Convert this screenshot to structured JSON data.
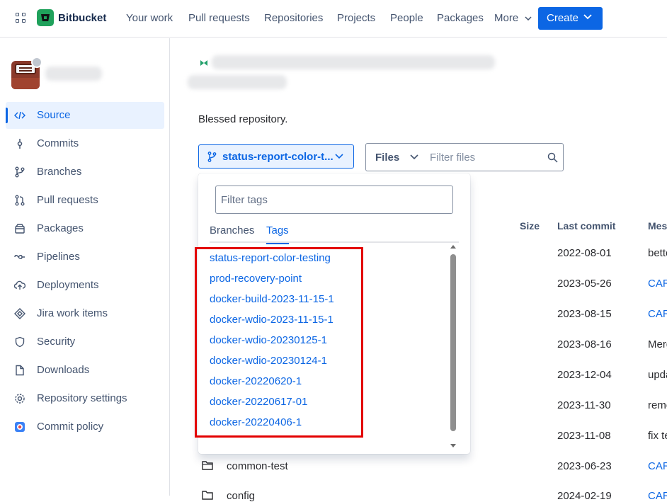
{
  "topnav": {
    "brand": "Bitbucket",
    "items": [
      "Your work",
      "Pull requests",
      "Repositories",
      "Projects",
      "People",
      "Packages",
      "More"
    ],
    "create_label": "Create"
  },
  "sidebar": {
    "items": [
      {
        "label": "Source",
        "icon": "code-icon",
        "active": true
      },
      {
        "label": "Commits",
        "icon": "commit-icon"
      },
      {
        "label": "Branches",
        "icon": "branch-icon"
      },
      {
        "label": "Pull requests",
        "icon": "pull-request-icon"
      },
      {
        "label": "Packages",
        "icon": "package-icon"
      },
      {
        "label": "Pipelines",
        "icon": "pipeline-icon"
      },
      {
        "label": "Deployments",
        "icon": "cloud-upload-icon"
      },
      {
        "label": "Jira work items",
        "icon": "jira-icon"
      },
      {
        "label": "Security",
        "icon": "shield-icon"
      },
      {
        "label": "Downloads",
        "icon": "file-icon"
      },
      {
        "label": "Repository settings",
        "icon": "gear-icon"
      },
      {
        "label": "Commit policy",
        "icon": "policy-icon"
      }
    ]
  },
  "main": {
    "description": "Blessed repository.",
    "branch_label": "status-report-color-t...",
    "files_label": "Files",
    "files_placeholder": "Filter files",
    "table_headers": {
      "size": "Size",
      "last_commit": "Last commit",
      "message": "Mes"
    },
    "rows": [
      {
        "name": "",
        "date": "2022-08-01",
        "msg": "bette",
        "link": false
      },
      {
        "name": "",
        "date": "2023-05-26",
        "msg": "CAR",
        "link": true
      },
      {
        "name": "",
        "date": "2023-08-15",
        "msg": "CAR",
        "link": true
      },
      {
        "name": "",
        "date": "2023-08-16",
        "msg": "Merg",
        "link": false
      },
      {
        "name": "",
        "date": "2023-12-04",
        "msg": "upda",
        "link": false
      },
      {
        "name": "",
        "date": "2023-11-30",
        "msg": "remo",
        "link": false
      },
      {
        "name": "",
        "date": "2023-11-08",
        "msg": "fix te",
        "link": false
      },
      {
        "name": "common-test",
        "date": "2023-06-23",
        "msg": "CAR",
        "link": true
      },
      {
        "name": "config",
        "date": "2024-02-19",
        "msg": "CAR",
        "link": true
      }
    ]
  },
  "dropdown": {
    "filter_placeholder": "Filter tags",
    "tab_branches": "Branches",
    "tab_tags": "Tags",
    "tags": [
      "status-report-color-testing",
      "prod-recovery-point",
      "docker-build-2023-11-15-1",
      "docker-wdio-2023-11-15-1",
      "docker-wdio-20230125-1",
      "docker-wdio-20230124-1",
      "docker-20220620-1",
      "docker-20220617-01",
      "docker-20220406-1"
    ]
  },
  "colors": {
    "accent": "#0c66e4",
    "highlight": "#e30000",
    "brand": "#1fa15b"
  }
}
